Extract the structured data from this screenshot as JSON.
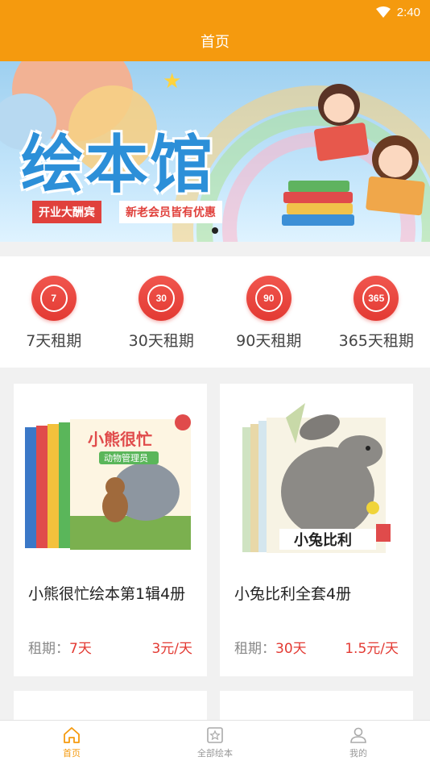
{
  "status_bar": {
    "time": "2:40",
    "wifi_icon": "wifi-icon"
  },
  "header": {
    "title": "首页"
  },
  "banner": {
    "title": "绘本馆",
    "tag_primary": "开业大酬宾",
    "tag_secondary": "新老会员皆有优惠",
    "active_slide": 1,
    "slide_count": 1
  },
  "periods": [
    {
      "badge": "7",
      "label": "7天租期"
    },
    {
      "badge": "30",
      "label": "30天租期"
    },
    {
      "badge": "90",
      "label": "90天租期"
    },
    {
      "badge": "365",
      "label": "365天租期"
    }
  ],
  "products": [
    {
      "name": "小熊很忙绘本第1辑4册",
      "period_key": "租期：",
      "period_value": "7天",
      "price": "3元/天",
      "cover_text": "小熊很忙",
      "cover_subtext": "动物管理员"
    },
    {
      "name": "小兔比利全套4册",
      "period_key": "租期：",
      "period_value": "30天",
      "price": "1.5元/天",
      "cover_text": "小兔比利"
    }
  ],
  "tabbar": [
    {
      "label": "首页",
      "icon": "home-icon",
      "active": true
    },
    {
      "label": "全部绘本",
      "icon": "books-icon",
      "active": false
    },
    {
      "label": "我的",
      "icon": "user-icon",
      "active": false
    }
  ],
  "colors": {
    "accent": "#f59a0e",
    "red": "#e33a33"
  }
}
